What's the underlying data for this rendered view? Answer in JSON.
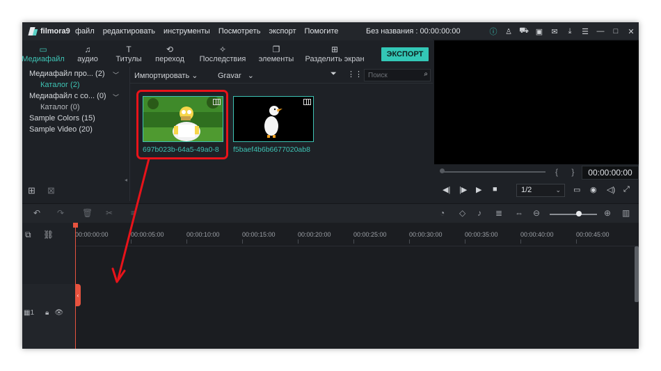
{
  "app": {
    "logo_text": "filmora9",
    "menu": [
      "файл",
      "редактировать",
      "инструменты",
      "Посмотреть",
      "экспорт",
      "Помогите"
    ],
    "doc_title": "Без названия : 00:00:00:00"
  },
  "toolbar": {
    "tabs": [
      {
        "label": "Медиафайл",
        "icon": "folder-icon",
        "active": true
      },
      {
        "label": "аудио",
        "icon": "music-note-icon"
      },
      {
        "label": "Титулы",
        "icon": "text-icon"
      },
      {
        "label": "переход",
        "icon": "transition-icon"
      },
      {
        "label": "Последствия",
        "icon": "effects-icon"
      },
      {
        "label": "элементы",
        "icon": "elements-icon"
      },
      {
        "label": "Разделить экран",
        "icon": "split-screen-icon"
      }
    ],
    "export_label": "ЭКСПОРТ"
  },
  "library": {
    "tree": [
      {
        "label": "Медиафайл про... (2)",
        "expanded": true
      },
      {
        "label": "Каталог (2)",
        "selected": true
      },
      {
        "label": "Медиафайл с со... (0)",
        "expanded": true
      },
      {
        "label": "Каталог (0)"
      },
      {
        "label": "Sample Colors (15)"
      },
      {
        "label": "Sample Video (20)"
      }
    ]
  },
  "media": {
    "import_label": "Импортировать",
    "record_label": "Gravar",
    "search_placeholder": "Поиск",
    "clips": [
      {
        "name": "697b023b-64a5-49a0-8",
        "selected": true
      },
      {
        "name": "f5baef4b6b6677020ab8"
      }
    ]
  },
  "preview": {
    "timecode": "00:00:00:00",
    "quality": "1/2"
  },
  "timeline": {
    "ticks": [
      "00:00:00:00",
      "00:00:05:00",
      "00:00:10:00",
      "00:00:15:00",
      "00:00:20:00",
      "00:00:25:00",
      "00:00:30:00",
      "00:00:35:00",
      "00:00:40:00",
      "00:00:45:00"
    ],
    "track_number": "1"
  },
  "colors": {
    "accent": "#33c7b6",
    "highlight_frame": "#e8131a",
    "playhead": "#e8533f",
    "background": "#1e2126"
  }
}
